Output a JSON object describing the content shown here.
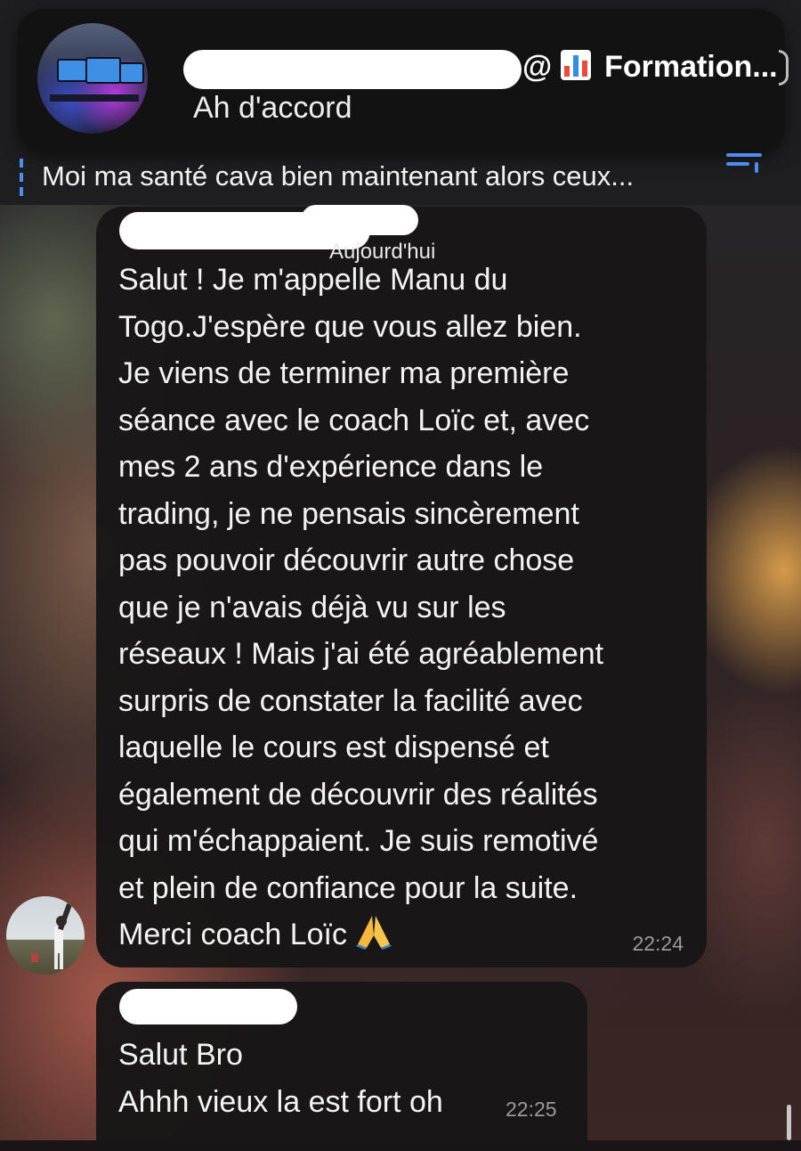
{
  "notification": {
    "title_suffix": "@",
    "title_group": "Formation...",
    "chart_icon": "bar-chart-emoji-icon",
    "message": "Ah d'accord"
  },
  "pinned": {
    "text": "Moi ma santé cava bien maintenant alors ceux...",
    "icon": "pinned-list-icon"
  },
  "date_separator": "Aujourd'hui",
  "messages": [
    {
      "text": "Salut ! Je m'appelle Manu du\nTogo.J'espère que vous allez bien.\nJe viens de terminer ma première\nséance avec le coach Loïc et, avec\nmes 2 ans d'expérience dans le\ntrading, je ne pensais sincèrement\npas pouvoir découvrir autre chose\nque je n'avais déjà vu sur les\nréseaux ! Mais j'ai été agréablement\nsurpris de constater la facilité avec\nlaquelle le cours est dispensé et\négalement de découvrir des réalités\nqui m'échappaient. Je suis remotivé\net plein de confiance pour la suite.\nMerci coach Loïc",
      "emoji": "pray-emoji-icon",
      "time": "22:24"
    },
    {
      "text": "Salut Bro\nAhhh vieux la est fort oh",
      "time": "22:25"
    }
  ],
  "colors": {
    "accent": "#4b8df0",
    "bubble": "#181617",
    "time": "#9a9a9a"
  }
}
